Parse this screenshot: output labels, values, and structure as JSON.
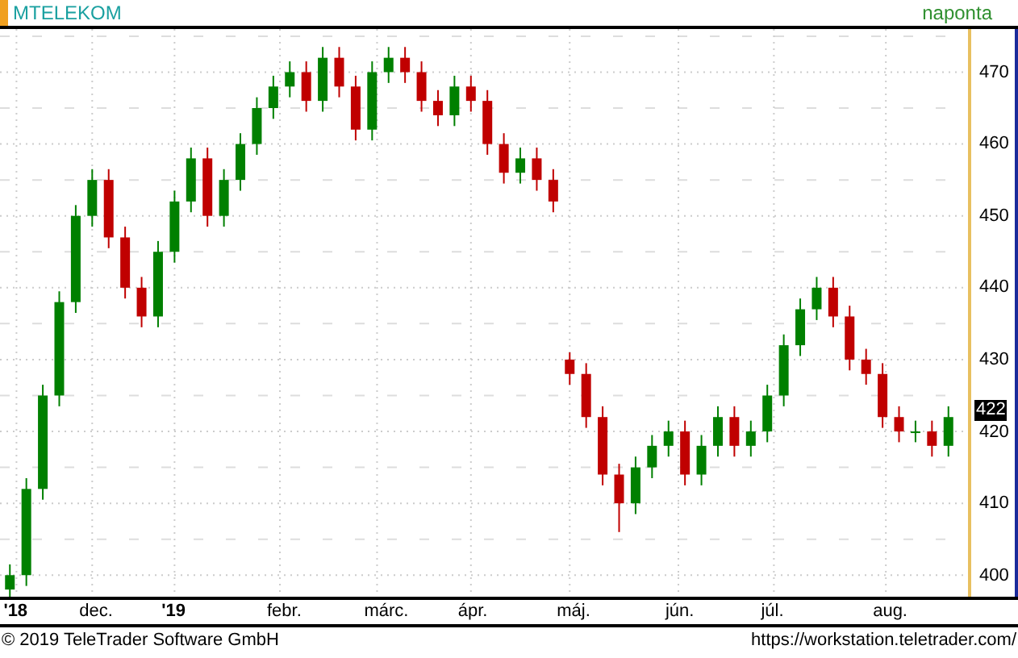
{
  "header": {
    "symbol": "MTELEKOM",
    "interval": "naponta"
  },
  "chart": {
    "last_price": "422",
    "month_labels": [
      {
        "label": "'18",
        "year": true
      },
      {
        "label": "dec.",
        "year": false
      },
      {
        "label": "'19",
        "year": true
      },
      {
        "label": "febr.",
        "year": false
      },
      {
        "label": "márc.",
        "year": false
      },
      {
        "label": "ápr.",
        "year": false
      },
      {
        "label": "máj.",
        "year": false
      },
      {
        "label": "jún.",
        "year": false
      },
      {
        "label": "júl.",
        "year": false
      },
      {
        "label": "aug.",
        "year": false
      }
    ],
    "chart_data": {
      "type": "candlestick",
      "ylim": [
        397,
        476
      ],
      "grid": true,
      "categories": [
        null,
        null,
        null,
        null,
        null,
        null,
        null,
        null,
        null,
        null,
        null,
        null,
        null,
        null,
        null,
        null,
        null,
        null,
        null,
        null,
        null,
        null,
        null,
        null,
        null,
        null,
        null,
        null,
        null,
        null,
        null,
        null,
        null,
        null,
        null,
        null,
        null,
        null,
        null,
        null,
        null,
        null,
        null,
        null,
        null,
        null,
        null,
        null,
        null,
        null,
        null,
        null,
        null,
        null,
        null,
        null,
        null,
        null
      ],
      "yticks": [
        {
          "value": 400,
          "label": "400"
        },
        {
          "value": 410,
          "label": "410"
        },
        {
          "value": 420,
          "label": "420"
        },
        {
          "value": 430,
          "label": "430"
        },
        {
          "value": 440,
          "label": "440"
        },
        {
          "value": 450,
          "label": "450"
        },
        {
          "value": 460,
          "label": "460"
        },
        {
          "value": 470,
          "label": "470"
        }
      ],
      "ohlc": [
        [
          398,
          401.5,
          397,
          400
        ],
        [
          400,
          413.5,
          398.5,
          412
        ],
        [
          412,
          426.5,
          410.5,
          425
        ],
        [
          425,
          439.5,
          423.5,
          438
        ],
        [
          438,
          451.5,
          436.5,
          450
        ],
        [
          450,
          456.5,
          448.5,
          455
        ],
        [
          455,
          456.5,
          445.5,
          447
        ],
        [
          447,
          448.5,
          438.5,
          440
        ],
        [
          440,
          441.5,
          434.5,
          436
        ],
        [
          436,
          446.5,
          434.5,
          445
        ],
        [
          445,
          453.5,
          443.5,
          452
        ],
        [
          452,
          459.5,
          450.5,
          458
        ],
        [
          458,
          459.5,
          448.5,
          450
        ],
        [
          450,
          456.5,
          448.5,
          455
        ],
        [
          455,
          461.5,
          453.5,
          460
        ],
        [
          460,
          466.5,
          458.5,
          465
        ],
        [
          465,
          469.5,
          463.5,
          468
        ],
        [
          468,
          471.5,
          466.5,
          470
        ],
        [
          470,
          471.5,
          464.5,
          466
        ],
        [
          466,
          473.5,
          464.5,
          472
        ],
        [
          472,
          473.5,
          466.5,
          468
        ],
        [
          468,
          469.5,
          460.5,
          462
        ],
        [
          462,
          471.5,
          460.5,
          470
        ],
        [
          470,
          473.5,
          468.5,
          472
        ],
        [
          472,
          473.5,
          468.5,
          470
        ],
        [
          470,
          471.5,
          464.5,
          466
        ],
        [
          466,
          467.5,
          462.5,
          464
        ],
        [
          464,
          469.5,
          462.5,
          468
        ],
        [
          468,
          469.5,
          464.5,
          466
        ],
        [
          466,
          467.5,
          458.5,
          460
        ],
        [
          460,
          461.5,
          454.5,
          456
        ],
        [
          456,
          459.5,
          454.5,
          458
        ],
        [
          458,
          459.5,
          453.5,
          455
        ],
        [
          455,
          456.5,
          450.5,
          452
        ],
        [
          430,
          431,
          426.5,
          428
        ],
        [
          428,
          429.5,
          420.5,
          422
        ],
        [
          422,
          423.5,
          412.5,
          414
        ],
        [
          414,
          415.5,
          406,
          410
        ],
        [
          410,
          416.5,
          408.5,
          415
        ],
        [
          415,
          419.5,
          413.5,
          418
        ],
        [
          418,
          421.5,
          416.5,
          420
        ],
        [
          420,
          421.5,
          412.5,
          414
        ],
        [
          414,
          419.5,
          412.5,
          418
        ],
        [
          418,
          423.5,
          416.5,
          422
        ],
        [
          422,
          423.5,
          416.5,
          418
        ],
        [
          418,
          421.5,
          416.5,
          420
        ],
        [
          420,
          426.5,
          418.5,
          425
        ],
        [
          425,
          433.5,
          423.5,
          432
        ],
        [
          432,
          438.5,
          430.5,
          437
        ],
        [
          437,
          441.5,
          435.5,
          440
        ],
        [
          440,
          441.5,
          434.5,
          436
        ],
        [
          436,
          437.5,
          428.5,
          430
        ],
        [
          430,
          431.5,
          426.5,
          428
        ],
        [
          428,
          429.5,
          420.5,
          422
        ],
        [
          422,
          423.5,
          418.5,
          420
        ],
        [
          420,
          421.5,
          418.5,
          420
        ],
        [
          420,
          421.5,
          416.5,
          418
        ],
        [
          418,
          423.5,
          416.5,
          422
        ]
      ]
    }
  },
  "footer": {
    "copyright": "© 2019 TeleTrader Software GmbH",
    "url": "https://workstation.teletrader.com/"
  }
}
